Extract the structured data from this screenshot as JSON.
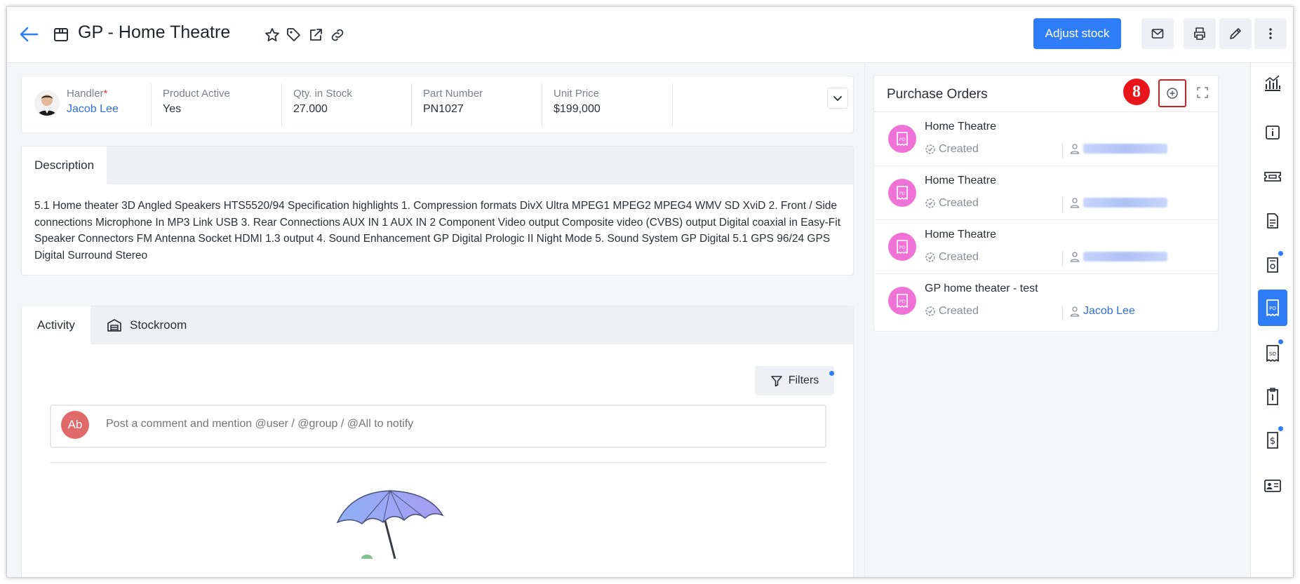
{
  "header": {
    "title": "GP - Home Theatre",
    "adjust_stock_label": "Adjust stock"
  },
  "summary": {
    "handler_label": "Handler",
    "handler_required": "*",
    "handler_value": "Jacob Lee",
    "product_active_label": "Product Active",
    "product_active_value": "Yes",
    "qty_label": "Qty. in Stock",
    "qty_value": "27.000",
    "part_label": "Part Number",
    "part_value": "PN1027",
    "price_label": "Unit Price",
    "price_value": "$199,000"
  },
  "description": {
    "tab_label": "Description",
    "text": "5.1 Home theater 3D Angled Speakers HTS5520/94 Specification highlights 1. Compression formats DivX Ultra MPEG1 MPEG2 MPEG4 WMV SD XviD 2. Front / Side connections Microphone In MP3 Link USB 3. Rear Connections AUX IN 1 AUX IN 2 Component Video output Composite video (CVBS) output Digital coaxial in Easy-Fit Speaker Connectors FM Antenna Socket HDMI 1.3 output 4. Sound Enhancement GP Digital Prologic II Night Mode 5. Sound System GP Digital 5.1 GPS 96/24 GPS Digital Surround Stereo"
  },
  "activity": {
    "tabs": [
      {
        "label": "Activity"
      },
      {
        "label": "Stockroom"
      }
    ],
    "filters_label": "Filters",
    "comment_avatar": "Ab",
    "comment_placeholder": "Post a comment and mention @user / @group / @All to notify"
  },
  "purchase_orders": {
    "title": "Purchase Orders",
    "step_badge": "8",
    "items": [
      {
        "name": "Home Theatre",
        "status": "Created",
        "user": ""
      },
      {
        "name": "Home Theatre",
        "status": "Created",
        "user": ""
      },
      {
        "name": "Home Theatre",
        "status": "Created",
        "user": ""
      },
      {
        "name": "GP home theater - test",
        "status": "Created",
        "user": "Jacob Lee"
      }
    ]
  },
  "colors": {
    "primary": "#2f7df6",
    "po_icon": "#ef72d6",
    "badge": "#e8161b",
    "link": "#2f6fe0"
  },
  "icons": {
    "header": [
      "back-arrow-icon",
      "product-box-icon",
      "star-icon",
      "tag-icon",
      "external-link-icon",
      "link-icon",
      "mail-icon",
      "print-icon",
      "edit-pencil-icon",
      "more-vertical-icon"
    ],
    "sidebar": [
      "analytics-chart-icon",
      "info-icon",
      "ticket-icon",
      "document-icon",
      "quote-icon",
      "purchase-order-icon",
      "sales-order-icon",
      "invoice-icon",
      "dollar-document-icon",
      "contact-card-icon"
    ]
  }
}
